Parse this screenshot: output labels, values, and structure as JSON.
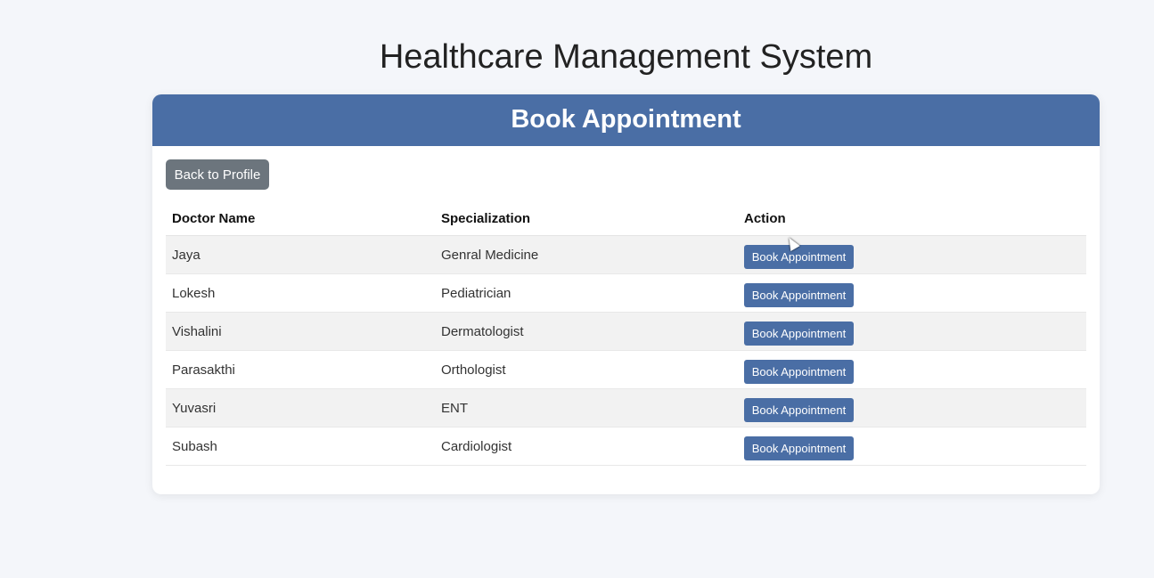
{
  "app": {
    "title": "Healthcare Management System"
  },
  "card": {
    "title": "Book Appointment",
    "back_button_label": "Back to Profile"
  },
  "table": {
    "headers": {
      "name": "Doctor Name",
      "specialization": "Specialization",
      "action": "Action"
    },
    "rows": [
      {
        "name": "Jaya",
        "specialization": "Genral Medicine",
        "action": "Book Appointment"
      },
      {
        "name": "Lokesh",
        "specialization": "Pediatrician",
        "action": "Book Appointment"
      },
      {
        "name": "Vishalini",
        "specialization": "Dermatologist",
        "action": "Book Appointment"
      },
      {
        "name": "Parasakthi",
        "specialization": "Orthologist",
        "action": "Book Appointment"
      },
      {
        "name": "Yuvasri",
        "specialization": "ENT",
        "action": "Book Appointment"
      },
      {
        "name": "Subash",
        "specialization": "Cardiologist",
        "action": "Book Appointment"
      }
    ]
  },
  "colors": {
    "primary": "#4a6ea5",
    "secondary_button": "#6c757d",
    "background": "#f4f6fa",
    "stripe": "#f2f2f2"
  }
}
